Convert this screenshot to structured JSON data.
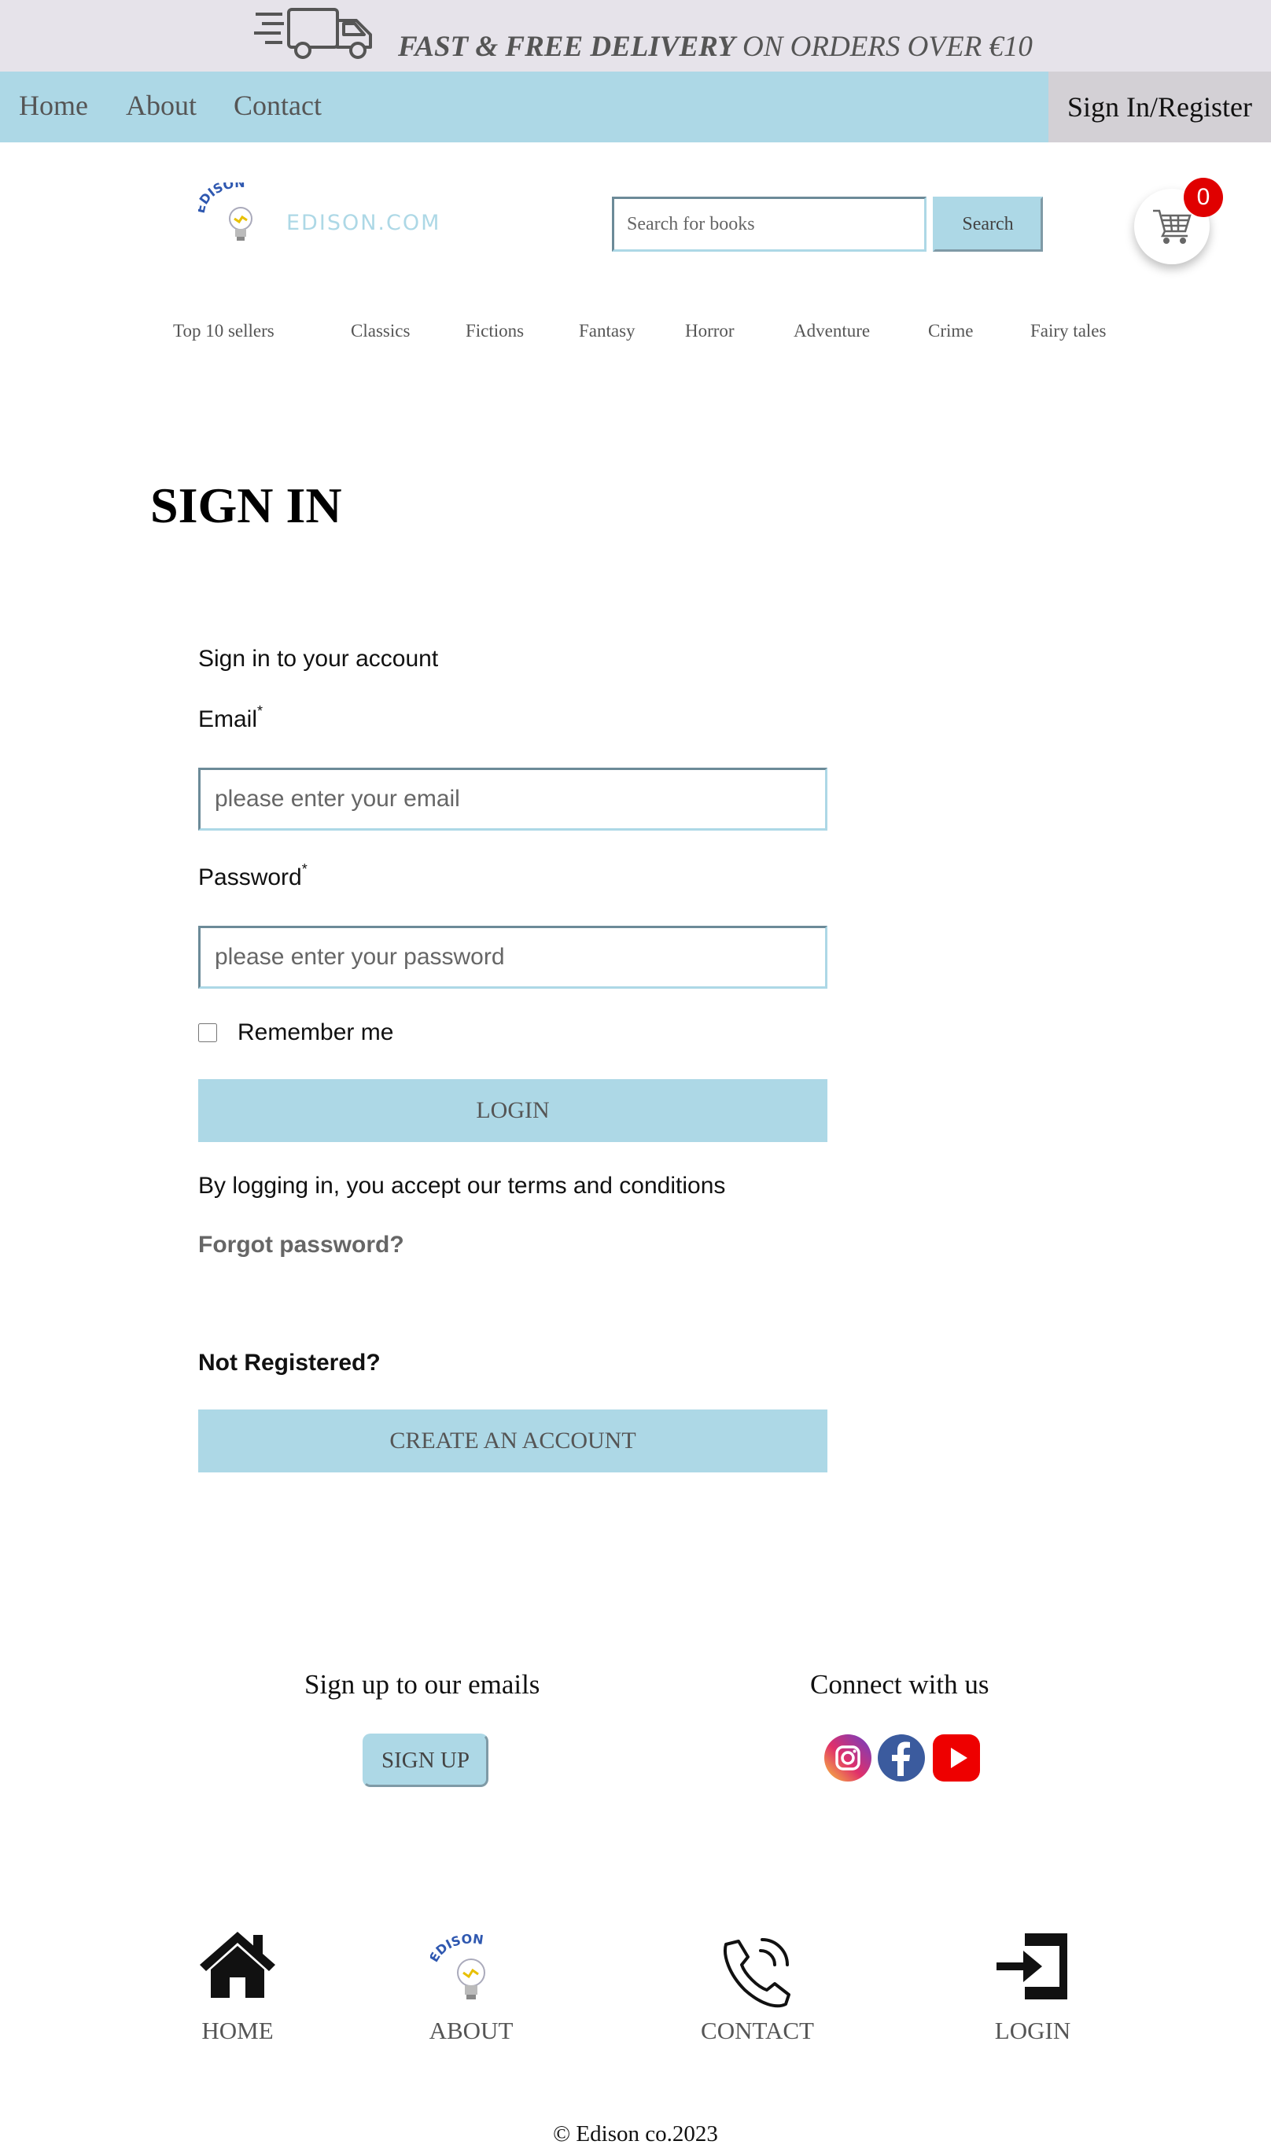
{
  "promo": {
    "bold_text": "FAST & FREE DELIVERY",
    "rest_text": " ON ORDERS OVER €10",
    "icon": "delivery-truck-icon"
  },
  "topnav": {
    "links": [
      "Home",
      "About",
      "Contact"
    ],
    "signin": "Sign In/Register"
  },
  "header": {
    "logo_arc": "EDISON",
    "logo_text": "EDISON.COM",
    "search_placeholder": "Search for books",
    "search_button": "Search",
    "cart_count": "0"
  },
  "categories": [
    "Top 10 sellers",
    "Classics",
    "Fictions",
    "Fantasy",
    "Horror",
    "Adventure",
    "Crime",
    "Fairy tales"
  ],
  "signin": {
    "title": "SIGN IN",
    "subtitle": "Sign in to your account",
    "email_label": "Email",
    "email_placeholder": "please enter your email",
    "password_label": "Password",
    "password_placeholder": "please enter your password",
    "required_mark": "*",
    "remember": "Remember me",
    "login_button": "LOGIN",
    "terms": "By logging in, you accept our terms and conditions",
    "forgot": "Forgot password?",
    "not_registered": "Not Registered?",
    "create_button": "CREATE AN ACCOUNT"
  },
  "footer": {
    "signup_heading": "Sign up to our emails",
    "signup_button": "SIGN UP",
    "connect_heading": "Connect with us",
    "social": [
      "instagram-icon",
      "facebook-icon",
      "youtube-icon"
    ],
    "nav": [
      {
        "label": "HOME",
        "icon": "home-icon"
      },
      {
        "label": "ABOUT",
        "icon": "edison-bulb-icon"
      },
      {
        "label": "CONTACT",
        "icon": "phone-icon"
      },
      {
        "label": "LOGIN",
        "icon": "login-icon"
      }
    ],
    "copyright": "© Edison co.2023"
  },
  "colors": {
    "accent": "#add8e6",
    "promo_bg": "#e6e3ea",
    "signin_bg": "#d3d0d5",
    "badge": "#e00000"
  }
}
